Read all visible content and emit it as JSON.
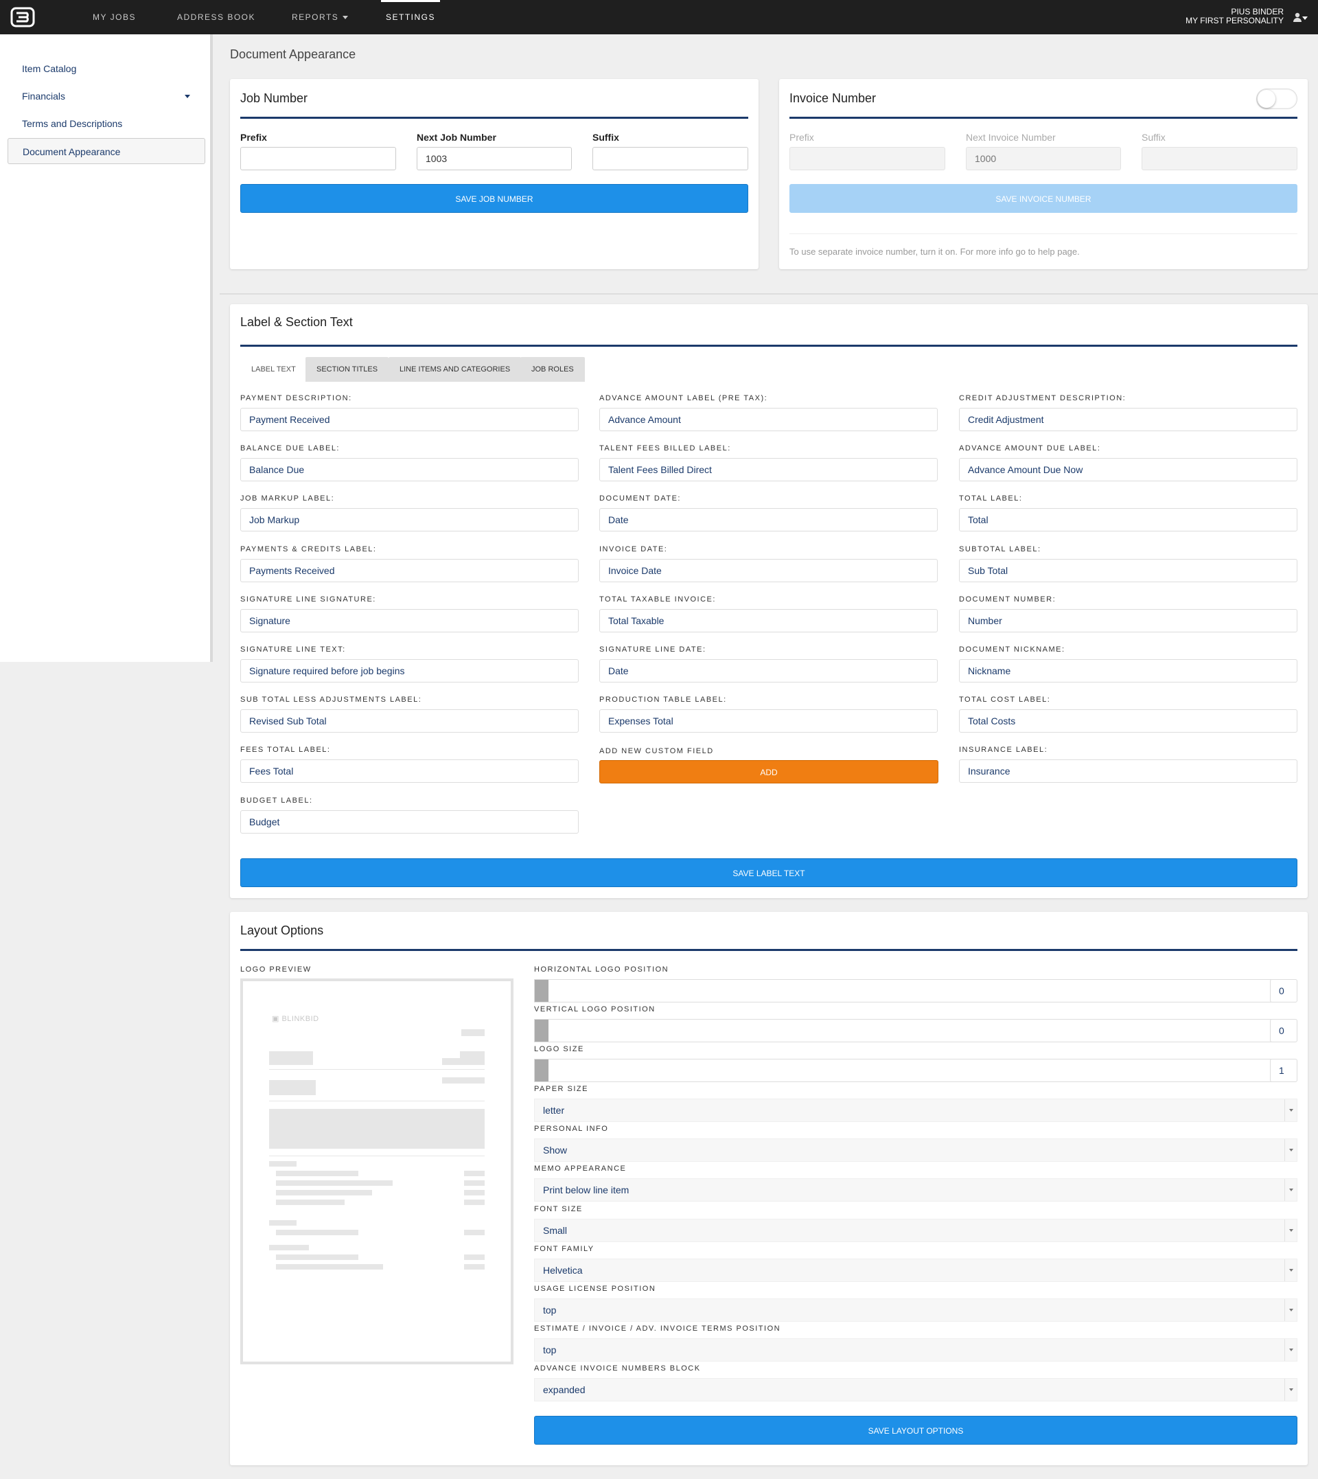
{
  "nav": {
    "items": [
      {
        "label": "MY JOBS"
      },
      {
        "label": "ADDRESS BOOK"
      },
      {
        "label": "REPORTS"
      },
      {
        "label": "SETTINGS"
      }
    ],
    "user_name": "PIUS BINDER",
    "user_company": "MY FIRST PERSONALITY"
  },
  "sidebar": {
    "items": [
      {
        "label": "Item Catalog"
      },
      {
        "label": "Financials"
      },
      {
        "label": "Terms and Descriptions"
      },
      {
        "label": "Document Appearance"
      }
    ]
  },
  "page_title": "Document Appearance",
  "job_number": {
    "title": "Job Number",
    "prefix_label": "Prefix",
    "prefix_value": "",
    "next_label": "Next Job Number",
    "next_value": "1003",
    "suffix_label": "Suffix",
    "suffix_value": "",
    "save_label": "SAVE JOB NUMBER"
  },
  "invoice_number": {
    "title": "Invoice Number",
    "enabled": false,
    "prefix_label": "Prefix",
    "next_label": "Next Invoice Number",
    "next_placeholder": "1000",
    "suffix_label": "Suffix",
    "save_label": "SAVE INVOICE NUMBER",
    "note": "To use separate invoice number, turn it on. For more info go to help page."
  },
  "label_section": {
    "title": "Label & Section Text",
    "tabs": [
      {
        "label": "LABEL TEXT"
      },
      {
        "label": "SECTION TITLES"
      },
      {
        "label": "LINE ITEMS AND CATEGORIES"
      },
      {
        "label": "JOB ROLES"
      }
    ],
    "col1": [
      {
        "label": "PAYMENT DESCRIPTION:",
        "value": "Payment Received"
      },
      {
        "label": "BALANCE DUE LABEL:",
        "value": "Balance Due"
      },
      {
        "label": "JOB MARKUP LABEL:",
        "value": "Job Markup"
      },
      {
        "label": "PAYMENTS & CREDITS LABEL:",
        "value": "Payments Received"
      },
      {
        "label": "SIGNATURE LINE SIGNATURE:",
        "value": "Signature"
      },
      {
        "label": "SIGNATURE LINE TEXT:",
        "value": "Signature required before job begins"
      },
      {
        "label": "SUB TOTAL LESS ADJUSTMENTS LABEL:",
        "value": "Revised Sub Total"
      },
      {
        "label": "FEES TOTAL LABEL:",
        "value": "Fees Total"
      },
      {
        "label": "BUDGET LABEL:",
        "value": "Budget"
      }
    ],
    "col2": [
      {
        "label": "ADVANCE AMOUNT LABEL (PRE TAX):",
        "value": "Advance Amount"
      },
      {
        "label": "TALENT FEES BILLED LABEL:",
        "value": "Talent Fees Billed Direct"
      },
      {
        "label": "DOCUMENT DATE:",
        "value": "Date"
      },
      {
        "label": "INVOICE DATE:",
        "value": "Invoice Date"
      },
      {
        "label": "TOTAL TAXABLE INVOICE:",
        "value": "Total Taxable"
      },
      {
        "label": "SIGNATURE LINE DATE:",
        "value": "Date"
      },
      {
        "label": "PRODUCTION TABLE LABEL:",
        "value": "Expenses Total"
      }
    ],
    "custom_field_label": "ADD NEW CUSTOM FIELD",
    "add_label": "ADD",
    "col3": [
      {
        "label": "CREDIT ADJUSTMENT DESCRIPTION:",
        "value": "Credit Adjustment"
      },
      {
        "label": "ADVANCE AMOUNT DUE LABEL:",
        "value": "Advance Amount Due Now"
      },
      {
        "label": "TOTAL LABEL:",
        "value": "Total"
      },
      {
        "label": "SUBTOTAL LABEL:",
        "value": "Sub Total"
      },
      {
        "label": "DOCUMENT NUMBER:",
        "value": "Number"
      },
      {
        "label": "DOCUMENT NICKNAME:",
        "value": "Nickname"
      },
      {
        "label": "TOTAL COST LABEL:",
        "value": "Total Costs"
      },
      {
        "label": "INSURANCE LABEL:",
        "value": "Insurance"
      }
    ],
    "save_label": "SAVE LABEL TEXT"
  },
  "layout_options": {
    "title": "Layout Options",
    "logo_preview_label": "LOGO PREVIEW",
    "preview_brand": "BLINKBID",
    "sliders": [
      {
        "label": "HORIZONTAL LOGO POSITION",
        "value": "0"
      },
      {
        "label": "VERTICAL LOGO POSITION",
        "value": "0"
      },
      {
        "label": "LOGO SIZE",
        "value": "1"
      }
    ],
    "selects": [
      {
        "label": "PAPER SIZE",
        "value": "letter"
      },
      {
        "label": "PERSONAL INFO",
        "value": "Show"
      },
      {
        "label": "MEMO APPEARANCE",
        "value": "Print below line item"
      },
      {
        "label": "FONT SIZE",
        "value": "Small"
      },
      {
        "label": "FONT FAMILY",
        "value": "Helvetica"
      },
      {
        "label": "USAGE LICENSE POSITION",
        "value": "top"
      },
      {
        "label": "ESTIMATE / INVOICE / ADV. INVOICE TERMS POSITION",
        "value": "top"
      },
      {
        "label": "ADVANCE INVOICE NUMBERS BLOCK",
        "value": "expanded"
      }
    ],
    "save_label": "SAVE LAYOUT OPTIONS"
  }
}
